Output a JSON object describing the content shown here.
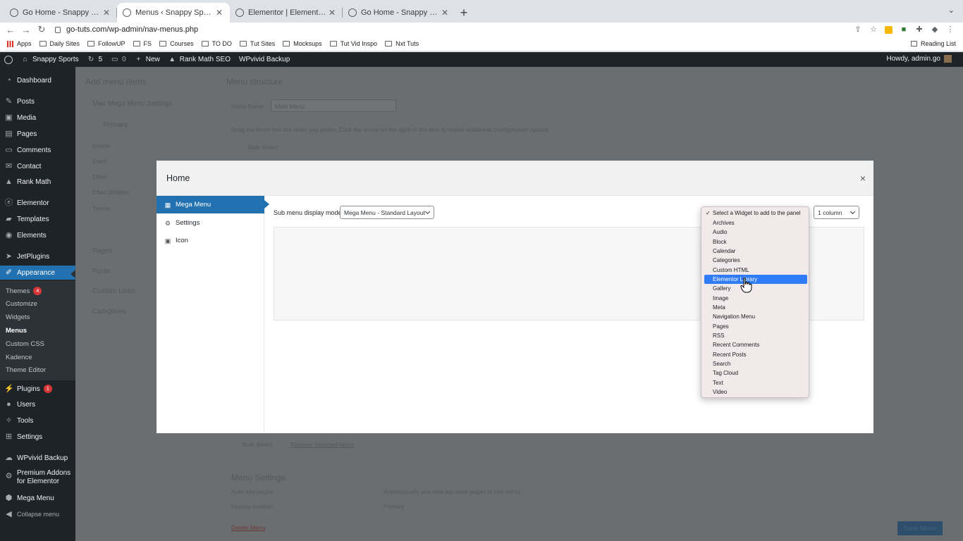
{
  "browser": {
    "tabs": [
      {
        "title": "Go Home - Snappy Sports",
        "active": false
      },
      {
        "title": "Menus ‹ Snappy Sports — WordPress",
        "active": true
      },
      {
        "title": "Elementor | Elementor Header",
        "active": false
      },
      {
        "title": "Go Home - Snappy Sports",
        "active": false
      }
    ],
    "new_tab": "+",
    "url": "go-tuts.com/wp-admin/nav-menus.php",
    "bookmarks": [
      "Apps",
      "Daily Sites",
      "FollowUP",
      "FS",
      "Courses",
      "TO DO",
      "Tut Sites",
      "Mocksups",
      "Tut Vid Inspo",
      "Nxt Tuts"
    ],
    "reading_list": "Reading List"
  },
  "adminbar": {
    "site_name": "Snappy Sports",
    "updates_count": "5",
    "comments_count": "0",
    "new_label": "New",
    "rank_math": "Rank Math SEO",
    "wpvivid": "WPvivid Backup",
    "howdy": "Howdy, admin.go"
  },
  "sidebar": {
    "items": [
      {
        "label": "Dashboard",
        "icon": "dashboard-icon"
      },
      {
        "label": "Posts",
        "icon": "pin-icon"
      },
      {
        "label": "Media",
        "icon": "media-icon"
      },
      {
        "label": "Pages",
        "icon": "page-icon"
      },
      {
        "label": "Comments",
        "icon": "comment-icon"
      },
      {
        "label": "Contact",
        "icon": "mail-icon"
      },
      {
        "label": "Rank Math",
        "icon": "chart-icon"
      },
      {
        "label": "Elementor",
        "icon": "elementor-icon"
      },
      {
        "label": "Templates",
        "icon": "folder-icon"
      },
      {
        "label": "Elements",
        "icon": "elements-icon"
      },
      {
        "label": "JetPlugins",
        "icon": "jet-icon"
      },
      {
        "label": "Appearance",
        "icon": "brush-icon"
      },
      {
        "label": "Plugins",
        "icon": "plugin-icon",
        "badge": "1"
      },
      {
        "label": "Users",
        "icon": "user-icon"
      },
      {
        "label": "Tools",
        "icon": "wrench-icon"
      },
      {
        "label": "Settings",
        "icon": "settings-icon"
      },
      {
        "label": "WPvivid Backup",
        "icon": "cloud-icon"
      },
      {
        "label": "Premium Addons",
        "label2": "for Elementor",
        "icon": "addons-icon"
      },
      {
        "label": "Mega Menu",
        "icon": "megamenu-icon"
      },
      {
        "label": "Collapse menu",
        "icon": "collapse-icon"
      }
    ],
    "submenu": [
      {
        "label": "Themes",
        "badge": "4"
      },
      {
        "label": "Customize"
      },
      {
        "label": "Widgets"
      },
      {
        "label": "Menus",
        "current": true
      },
      {
        "label": "Custom CSS"
      },
      {
        "label": "Kadence"
      },
      {
        "label": "Theme Editor"
      }
    ]
  },
  "background": {
    "add_menu_items": "Add menu items",
    "menu_structure": "Menu structure",
    "max_mega_menu_settings": "Max Mega Menu Settings",
    "primary": "Primary",
    "menu_name_label": "Menu Name",
    "menu_name_value": "Main Menu",
    "drag_hint": "Drag the items into the order you prefer. Click the arrow on the right of the item to reveal additional configuration options.",
    "bulk_select": "Bulk Select",
    "remove_selected": "Remove Selected Items",
    "enable": "Enable",
    "event": "Event",
    "effect": "Effect",
    "effect_mobile": "Effect (Mobile)",
    "theme": "Theme",
    "pages": "Pages",
    "posts": "Posts",
    "custom_links": "Custom Links",
    "categories": "Categories",
    "menu_settings": "Menu Settings",
    "auto_add_pages": "Auto add pages",
    "auto_add_desc": "Automatically add new top-level pages to this menu",
    "display_location": "Display location",
    "delete_menu": "Delete Menu",
    "save_menu": "Save Menu"
  },
  "modal": {
    "title": "Home",
    "close": "×",
    "tabs": [
      {
        "label": "Mega Menu",
        "icon": "grid-icon",
        "active": true
      },
      {
        "label": "Settings",
        "icon": "gear-icon",
        "active": false
      },
      {
        "label": "Icon",
        "icon": "image-icon",
        "active": false
      }
    ],
    "sub_menu_label": "Sub menu display mode",
    "display_mode": "Mega Menu - Standard Layout",
    "columns": "1 column"
  },
  "widget_dropdown": {
    "options": [
      "Select a Widget to add to the panel",
      "Archives",
      "Audio",
      "Block",
      "Calendar",
      "Categories",
      "Custom HTML",
      "Elementor Library",
      "Gallery",
      "Image",
      "Meta",
      "Navigation Menu",
      "Pages",
      "RSS",
      "Recent Comments",
      "Recent Posts",
      "Search",
      "Tag Cloud",
      "Text",
      "Video"
    ],
    "checked": "Select a Widget to add to the panel",
    "highlighted": "Elementor Library"
  },
  "colors": {
    "wp_admin_dark": "#1d2327",
    "wp_blue": "#2271b1",
    "mac_select_blue": "#2f7cf6",
    "badge_red": "#d63638"
  }
}
